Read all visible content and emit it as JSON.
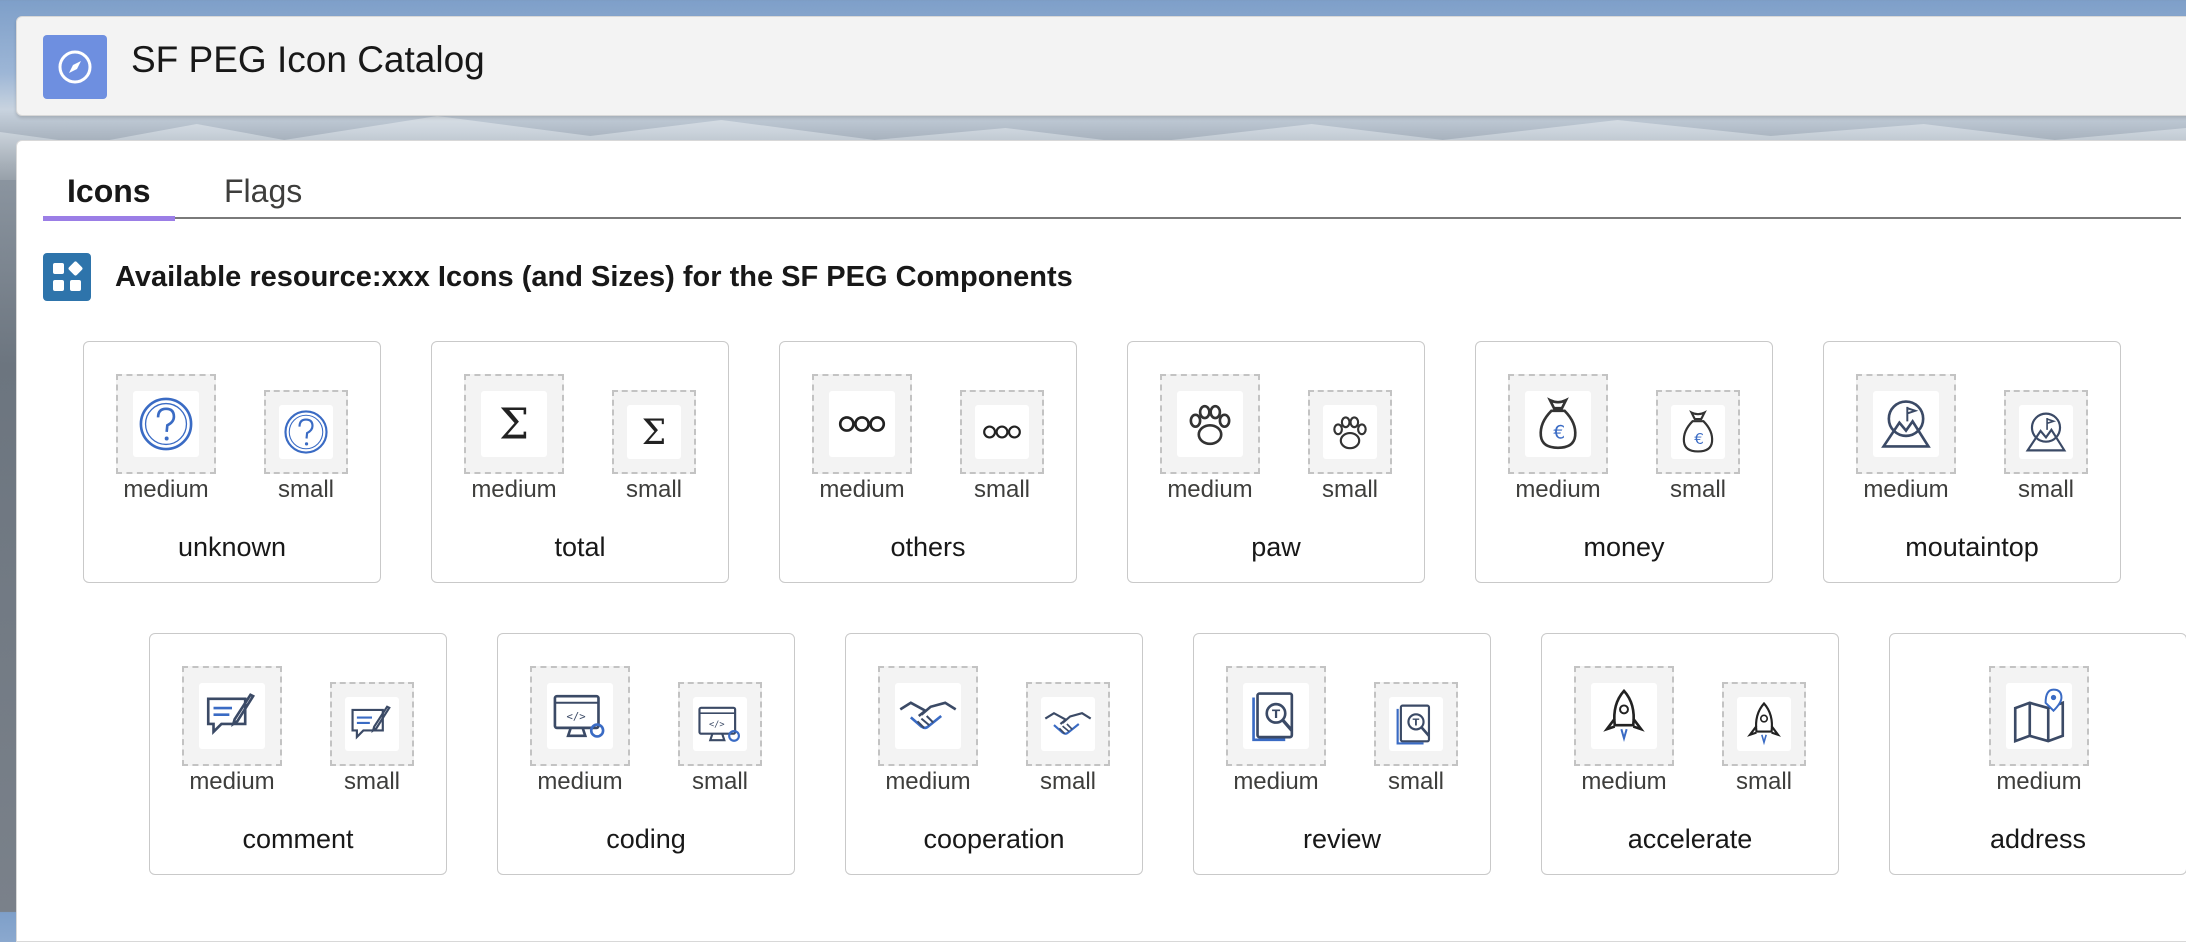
{
  "header": {
    "title": "SF PEG Icon Catalog",
    "icon": "compass-icon"
  },
  "tabs": [
    {
      "label": "Icons",
      "active": true
    },
    {
      "label": "Flags",
      "active": false
    }
  ],
  "section": {
    "title": "Available resource:xxx Icons (and Sizes) for the SF PEG Components",
    "icon": "apps-icon"
  },
  "size_labels": {
    "medium": "medium",
    "small": "small"
  },
  "tiles": [
    {
      "name": "unknown",
      "icon": "question-mark-icon"
    },
    {
      "name": "total",
      "icon": "sigma-icon"
    },
    {
      "name": "others",
      "icon": "three-circles-icon"
    },
    {
      "name": "paw",
      "icon": "paw-icon"
    },
    {
      "name": "money",
      "icon": "money-bag-euro-icon"
    },
    {
      "name": "moutaintop",
      "icon": "mountain-flag-icon"
    },
    {
      "name": "comment",
      "icon": "comment-pen-icon"
    },
    {
      "name": "coding",
      "icon": "code-monitor-icon"
    },
    {
      "name": "cooperation",
      "icon": "handshake-icon"
    },
    {
      "name": "review",
      "icon": "document-review-icon"
    },
    {
      "name": "accelerate",
      "icon": "rocket-icon"
    },
    {
      "name": "address",
      "icon": "map-pin-icon"
    }
  ],
  "colors": {
    "accent_tab": "#9b7ee6",
    "header_icon_bg": "#6e8fe0",
    "section_icon_bg": "#2e74ab",
    "icon_stroke": "#3b4a66",
    "icon_blue": "#3a6bc4"
  }
}
